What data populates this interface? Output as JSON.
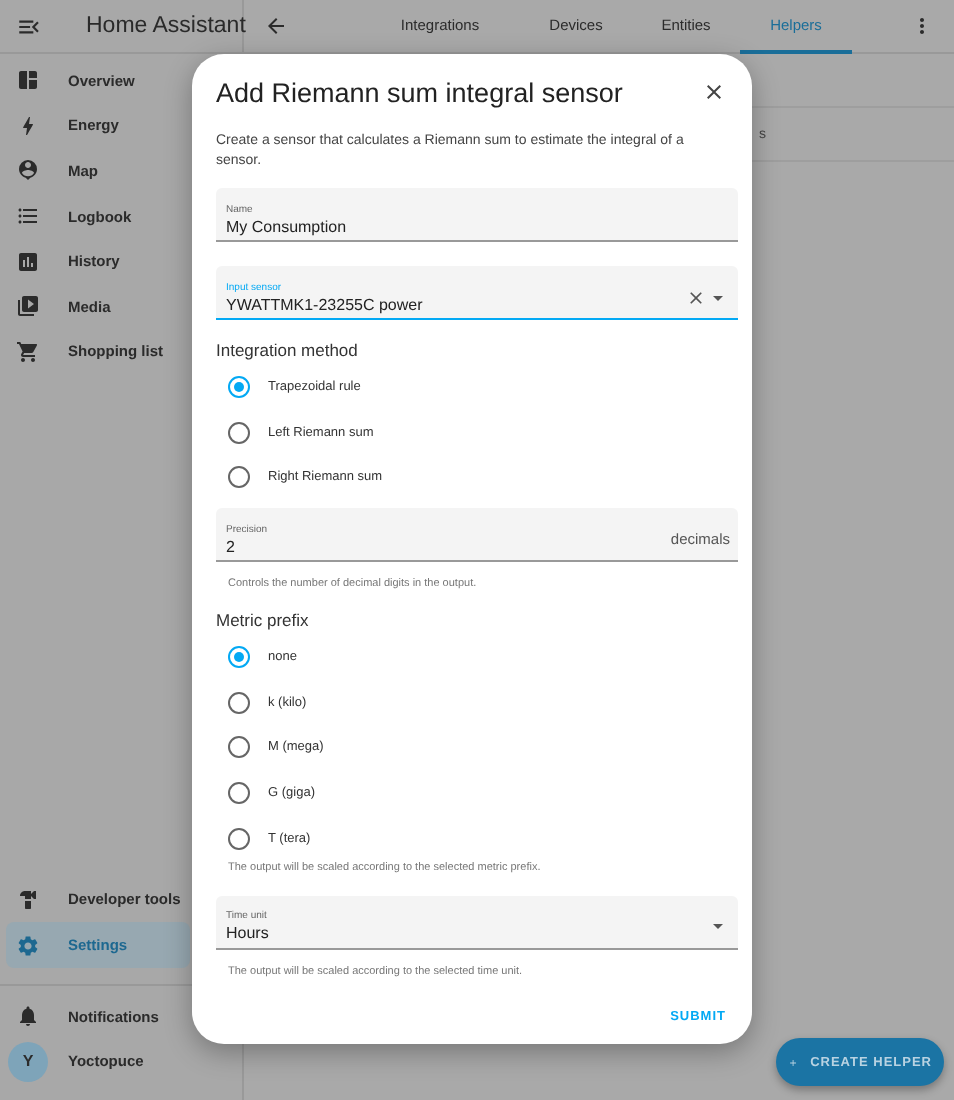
{
  "sidebar": {
    "title": "Home Assistant",
    "items": [
      {
        "label": "Overview",
        "selected": false
      },
      {
        "label": "Energy",
        "selected": false
      },
      {
        "label": "Map",
        "selected": false
      },
      {
        "label": "Logbook",
        "selected": false
      },
      {
        "label": "History",
        "selected": false
      },
      {
        "label": "Media",
        "selected": false
      },
      {
        "label": "Shopping list",
        "selected": false
      }
    ],
    "bottom_items": [
      {
        "label": "Developer tools",
        "selected": false
      },
      {
        "label": "Settings",
        "selected": true
      }
    ],
    "notifications": {
      "label": "Notifications"
    },
    "user": {
      "initial": "Y",
      "name": "Yoctopuce"
    }
  },
  "topbar": {
    "tabs": [
      {
        "label": "Integrations",
        "selected": false
      },
      {
        "label": "Devices",
        "selected": false
      },
      {
        "label": "Entities",
        "selected": false
      },
      {
        "label": "Helpers",
        "selected": true
      }
    ]
  },
  "list_behind": {
    "row_text": "s"
  },
  "dialog": {
    "title": "Add Riemann sum integral sensor",
    "description": "Create a sensor that calculates a Riemann sum to estimate the integral of a sensor.",
    "name_field": {
      "label": "Name",
      "value": "My Consumption",
      "focused": false
    },
    "input_sensor": {
      "label": "Input sensor",
      "value": "YWATTMK1-23255C power",
      "focused": true
    },
    "integration_method": {
      "label": "Integration method",
      "options": [
        {
          "label": "Trapezoidal rule",
          "selected": true
        },
        {
          "label": "Left Riemann sum",
          "selected": false
        },
        {
          "label": "Right Riemann sum",
          "selected": false
        }
      ]
    },
    "precision": {
      "label": "Precision",
      "value": "2",
      "suffix": "decimals",
      "helper": "Controls the number of decimal digits in the output.",
      "focused": false
    },
    "metric_prefix": {
      "label": "Metric prefix",
      "options": [
        {
          "label": "none",
          "selected": true
        },
        {
          "label": "k (kilo)",
          "selected": false
        },
        {
          "label": "M (mega)",
          "selected": false
        },
        {
          "label": "G (giga)",
          "selected": false
        },
        {
          "label": "T (tera)",
          "selected": false
        }
      ],
      "helper": "The output will be scaled according to the selected metric prefix."
    },
    "time_unit": {
      "label": "Time unit",
      "value": "Hours",
      "helper": "The output will be scaled according to the selected time unit.",
      "focused": false
    },
    "submit": "SUBMIT"
  },
  "fab": {
    "label": "CREATE HELPER"
  }
}
